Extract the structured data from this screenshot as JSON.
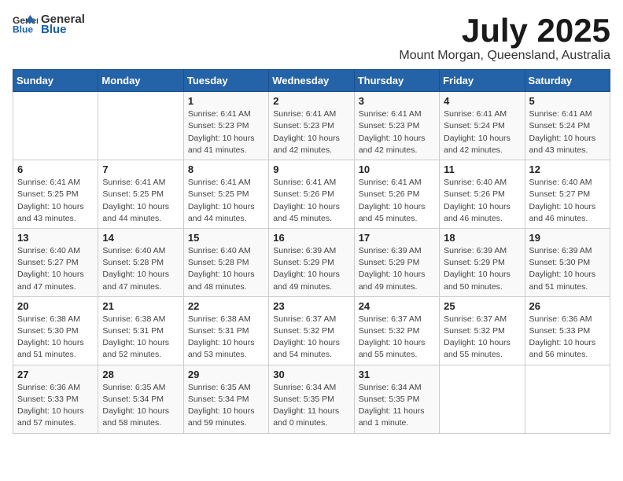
{
  "header": {
    "logo_general": "General",
    "logo_blue": "Blue",
    "month_title": "July 2025",
    "location": "Mount Morgan, Queensland, Australia"
  },
  "weekdays": [
    "Sunday",
    "Monday",
    "Tuesday",
    "Wednesday",
    "Thursday",
    "Friday",
    "Saturday"
  ],
  "weeks": [
    [
      {
        "day": "",
        "info": ""
      },
      {
        "day": "",
        "info": ""
      },
      {
        "day": "1",
        "info": "Sunrise: 6:41 AM\nSunset: 5:23 PM\nDaylight: 10 hours and 41 minutes."
      },
      {
        "day": "2",
        "info": "Sunrise: 6:41 AM\nSunset: 5:23 PM\nDaylight: 10 hours and 42 minutes."
      },
      {
        "day": "3",
        "info": "Sunrise: 6:41 AM\nSunset: 5:23 PM\nDaylight: 10 hours and 42 minutes."
      },
      {
        "day": "4",
        "info": "Sunrise: 6:41 AM\nSunset: 5:24 PM\nDaylight: 10 hours and 42 minutes."
      },
      {
        "day": "5",
        "info": "Sunrise: 6:41 AM\nSunset: 5:24 PM\nDaylight: 10 hours and 43 minutes."
      }
    ],
    [
      {
        "day": "6",
        "info": "Sunrise: 6:41 AM\nSunset: 5:25 PM\nDaylight: 10 hours and 43 minutes."
      },
      {
        "day": "7",
        "info": "Sunrise: 6:41 AM\nSunset: 5:25 PM\nDaylight: 10 hours and 44 minutes."
      },
      {
        "day": "8",
        "info": "Sunrise: 6:41 AM\nSunset: 5:25 PM\nDaylight: 10 hours and 44 minutes."
      },
      {
        "day": "9",
        "info": "Sunrise: 6:41 AM\nSunset: 5:26 PM\nDaylight: 10 hours and 45 minutes."
      },
      {
        "day": "10",
        "info": "Sunrise: 6:41 AM\nSunset: 5:26 PM\nDaylight: 10 hours and 45 minutes."
      },
      {
        "day": "11",
        "info": "Sunrise: 6:40 AM\nSunset: 5:26 PM\nDaylight: 10 hours and 46 minutes."
      },
      {
        "day": "12",
        "info": "Sunrise: 6:40 AM\nSunset: 5:27 PM\nDaylight: 10 hours and 46 minutes."
      }
    ],
    [
      {
        "day": "13",
        "info": "Sunrise: 6:40 AM\nSunset: 5:27 PM\nDaylight: 10 hours and 47 minutes."
      },
      {
        "day": "14",
        "info": "Sunrise: 6:40 AM\nSunset: 5:28 PM\nDaylight: 10 hours and 47 minutes."
      },
      {
        "day": "15",
        "info": "Sunrise: 6:40 AM\nSunset: 5:28 PM\nDaylight: 10 hours and 48 minutes."
      },
      {
        "day": "16",
        "info": "Sunrise: 6:39 AM\nSunset: 5:29 PM\nDaylight: 10 hours and 49 minutes."
      },
      {
        "day": "17",
        "info": "Sunrise: 6:39 AM\nSunset: 5:29 PM\nDaylight: 10 hours and 49 minutes."
      },
      {
        "day": "18",
        "info": "Sunrise: 6:39 AM\nSunset: 5:29 PM\nDaylight: 10 hours and 50 minutes."
      },
      {
        "day": "19",
        "info": "Sunrise: 6:39 AM\nSunset: 5:30 PM\nDaylight: 10 hours and 51 minutes."
      }
    ],
    [
      {
        "day": "20",
        "info": "Sunrise: 6:38 AM\nSunset: 5:30 PM\nDaylight: 10 hours and 51 minutes."
      },
      {
        "day": "21",
        "info": "Sunrise: 6:38 AM\nSunset: 5:31 PM\nDaylight: 10 hours and 52 minutes."
      },
      {
        "day": "22",
        "info": "Sunrise: 6:38 AM\nSunset: 5:31 PM\nDaylight: 10 hours and 53 minutes."
      },
      {
        "day": "23",
        "info": "Sunrise: 6:37 AM\nSunset: 5:32 PM\nDaylight: 10 hours and 54 minutes."
      },
      {
        "day": "24",
        "info": "Sunrise: 6:37 AM\nSunset: 5:32 PM\nDaylight: 10 hours and 55 minutes."
      },
      {
        "day": "25",
        "info": "Sunrise: 6:37 AM\nSunset: 5:32 PM\nDaylight: 10 hours and 55 minutes."
      },
      {
        "day": "26",
        "info": "Sunrise: 6:36 AM\nSunset: 5:33 PM\nDaylight: 10 hours and 56 minutes."
      }
    ],
    [
      {
        "day": "27",
        "info": "Sunrise: 6:36 AM\nSunset: 5:33 PM\nDaylight: 10 hours and 57 minutes."
      },
      {
        "day": "28",
        "info": "Sunrise: 6:35 AM\nSunset: 5:34 PM\nDaylight: 10 hours and 58 minutes."
      },
      {
        "day": "29",
        "info": "Sunrise: 6:35 AM\nSunset: 5:34 PM\nDaylight: 10 hours and 59 minutes."
      },
      {
        "day": "30",
        "info": "Sunrise: 6:34 AM\nSunset: 5:35 PM\nDaylight: 11 hours and 0 minutes."
      },
      {
        "day": "31",
        "info": "Sunrise: 6:34 AM\nSunset: 5:35 PM\nDaylight: 11 hours and 1 minute."
      },
      {
        "day": "",
        "info": ""
      },
      {
        "day": "",
        "info": ""
      }
    ]
  ]
}
